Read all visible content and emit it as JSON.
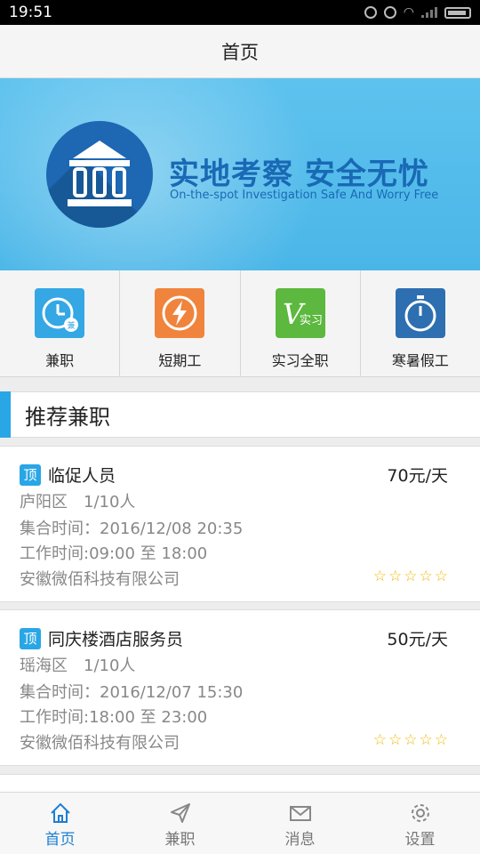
{
  "status_bar": {
    "time": "19:51"
  },
  "header": {
    "title": "首页"
  },
  "banner": {
    "slogan": "实地考察 安全无忧",
    "slogan_en": "On-the-spot Investigation Safe And Worry Free"
  },
  "categories": [
    {
      "label": "兼职",
      "icon": "clock-icon",
      "color": "#34a7e4"
    },
    {
      "label": "短期工",
      "icon": "lightning-icon",
      "color": "#f0843c"
    },
    {
      "label": "实习全职",
      "icon": "internship-icon",
      "color": "#5cb83e",
      "icon_text": "实习"
    },
    {
      "label": "寒暑假工",
      "icon": "stopwatch-icon",
      "color": "#2d6fb0"
    }
  ],
  "section": {
    "title": "推荐兼职"
  },
  "jobs": [
    {
      "badge": "顶",
      "title": "临促人员",
      "salary": "70元/天",
      "district": "庐阳区",
      "headcount": "1/10人",
      "gather_time": "集合时间：2016/12/08 20:35",
      "work_time": "工作时间:09:00 至 18:00",
      "company": "安徽微佰科技有限公司",
      "stars_filled": 0,
      "stars_total": 5
    },
    {
      "badge": "顶",
      "title": "同庆楼酒店服务员",
      "salary": "50元/天",
      "district": "瑶海区",
      "headcount": "1/10人",
      "gather_time": "集合时间：2016/12/07 15:30",
      "work_time": "工作时间:18:00 至 23:00",
      "company": "安徽微佰科技有限公司",
      "stars_filled": 0,
      "stars_total": 5
    }
  ],
  "bottom_nav": [
    {
      "label": "首页",
      "icon": "home-icon",
      "active": true
    },
    {
      "label": "兼职",
      "icon": "send-icon",
      "active": false
    },
    {
      "label": "消息",
      "icon": "mail-icon",
      "active": false
    },
    {
      "label": "设置",
      "icon": "gear-icon",
      "active": false
    }
  ],
  "colors": {
    "accent": "#29a6e6",
    "nav_active": "#1e7fd0",
    "banner_bg": "#4ab6e8",
    "banner_text": "#1969b5"
  }
}
